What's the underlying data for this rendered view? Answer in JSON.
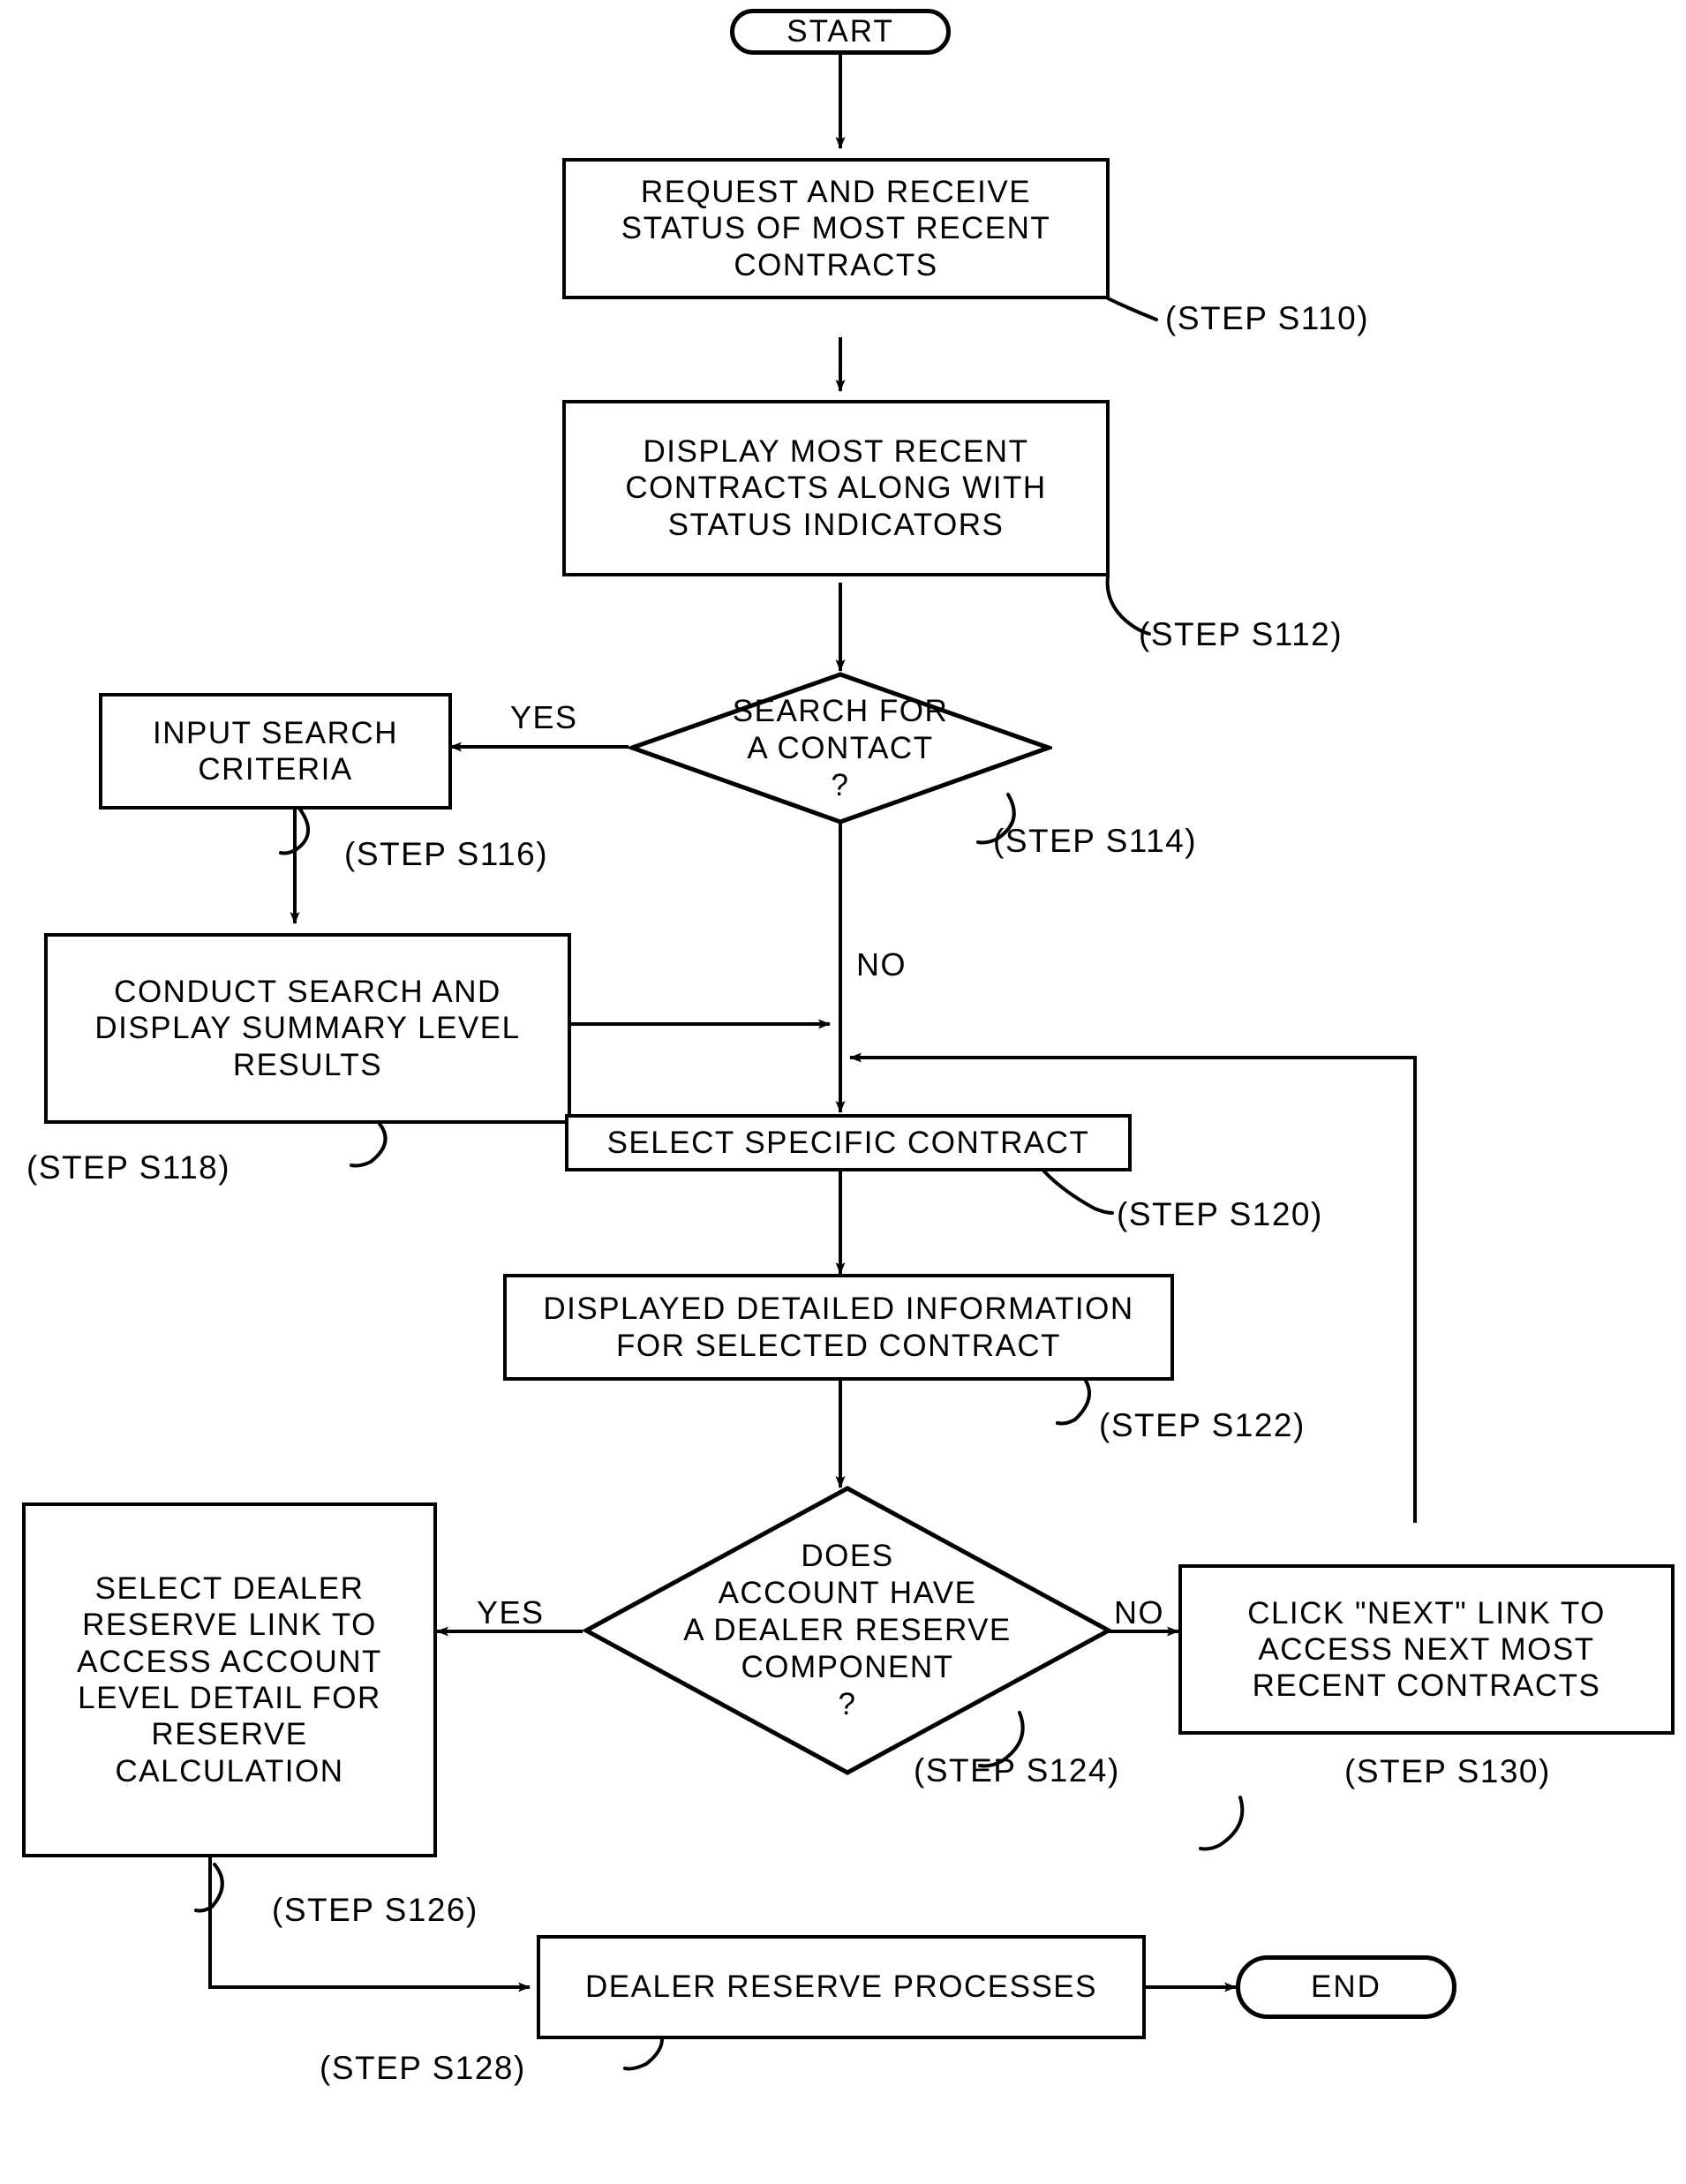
{
  "diagram": {
    "type": "flowchart",
    "title": "",
    "nodes": [
      {
        "id": "start",
        "shape": "terminal",
        "text": "START"
      },
      {
        "id": "s110",
        "shape": "process",
        "text": "REQUEST AND RECEIVE\nSTATUS OF MOST RECENT\nCONTRACTS"
      },
      {
        "id": "s112",
        "shape": "process",
        "text": "DISPLAY MOST RECENT\nCONTRACTS ALONG WITH\nSTATUS INDICATORS"
      },
      {
        "id": "s114",
        "shape": "decision",
        "text": "SEARCH FOR\nA CONTACT\n?"
      },
      {
        "id": "s116",
        "shape": "process",
        "text": "INPUT SEARCH\nCRITERIA"
      },
      {
        "id": "s118",
        "shape": "process",
        "text": "CONDUCT SEARCH AND\nDISPLAY SUMMARY LEVEL\nRESULTS"
      },
      {
        "id": "s120",
        "shape": "process",
        "text": "SELECT SPECIFIC CONTRACT"
      },
      {
        "id": "s122",
        "shape": "process",
        "text": "DISPLAYED DETAILED INFORMATION\nFOR SELECTED CONTRACT"
      },
      {
        "id": "s124",
        "shape": "decision",
        "text": "DOES\nACCOUNT HAVE\nA DEALER RESERVE\nCOMPONENT\n?"
      },
      {
        "id": "s126",
        "shape": "process",
        "text": "SELECT DEALER\nRESERVE LINK TO\nACCESS ACCOUNT\nLEVEL DETAIL FOR\nRESERVE\nCALCULATION"
      },
      {
        "id": "s130",
        "shape": "process",
        "text": "CLICK \"NEXT\" LINK TO\nACCESS NEXT MOST\nRECENT CONTRACTS"
      },
      {
        "id": "s128",
        "shape": "process",
        "text": "DEALER RESERVE PROCESSES"
      },
      {
        "id": "end",
        "shape": "terminal",
        "text": "END"
      }
    ],
    "step_labels": [
      {
        "id": "lbl_s110",
        "text": "(STEP S110)"
      },
      {
        "id": "lbl_s112",
        "text": "(STEP S112)"
      },
      {
        "id": "lbl_s114",
        "text": "(STEP S114)"
      },
      {
        "id": "lbl_s116",
        "text": "(STEP S116)"
      },
      {
        "id": "lbl_s118",
        "text": "(STEP S118)"
      },
      {
        "id": "lbl_s120",
        "text": "(STEP S120)"
      },
      {
        "id": "lbl_s122",
        "text": "(STEP S122)"
      },
      {
        "id": "lbl_s124",
        "text": "(STEP S124)"
      },
      {
        "id": "lbl_s126",
        "text": "(STEP S126)"
      },
      {
        "id": "lbl_s128",
        "text": "(STEP S128)"
      },
      {
        "id": "lbl_s130",
        "text": "(STEP S130)"
      }
    ],
    "branch_labels": [
      {
        "id": "yes_s114",
        "text": "YES"
      },
      {
        "id": "no_s114",
        "text": "NO"
      },
      {
        "id": "yes_s124",
        "text": "YES"
      },
      {
        "id": "no_s124",
        "text": "NO"
      }
    ],
    "colors": {
      "stroke": "#000000",
      "fill": "#ffffff",
      "text": "#000000"
    }
  }
}
